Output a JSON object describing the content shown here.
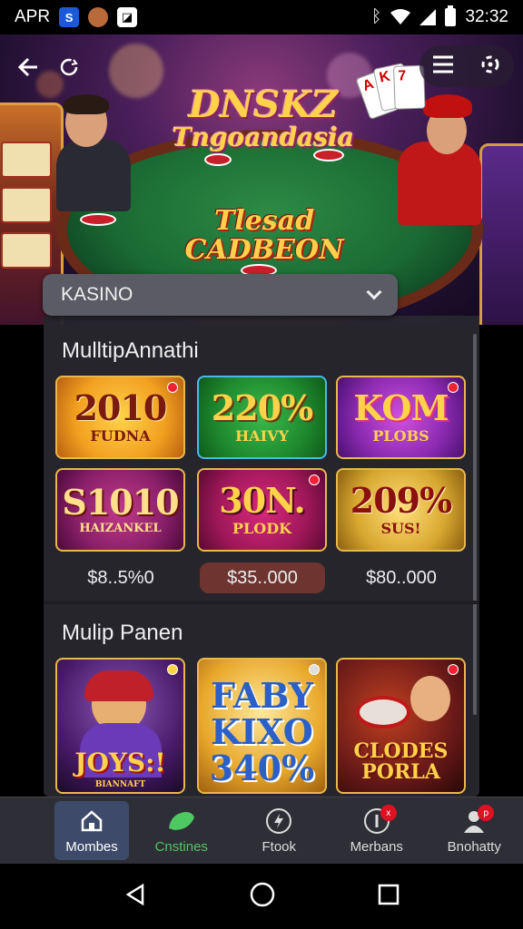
{
  "status_bar": {
    "carrier": "APR",
    "time": "32:32",
    "icons": [
      "notification-s-icon",
      "app-icon",
      "gallery-icon",
      "bluetooth-icon",
      "wifi-icon",
      "signal-icon",
      "battery-icon"
    ]
  },
  "hero": {
    "title_line1": "DNSKZ",
    "title_line2": "Tngoandasia",
    "subtitle_line1": "Tlesad",
    "subtitle_line2": "CADBEON",
    "cards": [
      "A",
      "K",
      "7"
    ]
  },
  "category_dropdown": {
    "selected": "KASINO"
  },
  "sections": [
    {
      "title": "MulltipAnnathi",
      "promos": [
        {
          "big": "2010",
          "small": "FUDNA",
          "bg": "#f2a020",
          "color": "#7a1a10"
        },
        {
          "big": "220%",
          "small": "HAIVY",
          "bg": "#1f8a2f",
          "color": "#ffd24a"
        },
        {
          "big": "KOM",
          "small": "PLOBS",
          "bg": "#8a2ab0",
          "color": "#ffd24a"
        },
        {
          "big": "S1010",
          "small": "HAIZANKEL",
          "bg": "#8a1f6a",
          "color": "#ffe08a"
        },
        {
          "big": "30N.",
          "small": "PLODK",
          "bg": "#a0185a",
          "color": "#ffd24a"
        },
        {
          "big": "209%",
          "small": "SUS!",
          "bg": "#d8a830",
          "color": "#8a1010"
        }
      ],
      "prices": [
        "$8..5%0",
        "$35..000",
        "$80..000"
      ]
    },
    {
      "title": "Mulip Panen",
      "games": [
        {
          "title": "JOYS:!",
          "sub": "BIANNAFT",
          "bg": "#4a1a6a"
        },
        {
          "title": "FABY KIXO 340%",
          "sub": "",
          "bg": "#e8a82a"
        },
        {
          "title": "CLODES PORLA",
          "sub": "",
          "bg": "#6a1a18"
        }
      ]
    }
  ],
  "bottom_nav": [
    {
      "label": "Mombes",
      "icon": "home-icon"
    },
    {
      "label": "Cnstines",
      "icon": "leaf-icon"
    },
    {
      "label": "Ftook",
      "icon": "bolt-icon"
    },
    {
      "label": "Merbans",
      "icon": "info-icon",
      "badge": "x"
    },
    {
      "label": "Bnohatty",
      "icon": "profile-icon",
      "badge": "p"
    }
  ],
  "colors": {
    "panel_bg": "#28262e",
    "nav_bg": "#2e2e36",
    "active_nav": "#3d4a6a",
    "gold": "#e8b84a",
    "price_active": "#6e3430"
  }
}
